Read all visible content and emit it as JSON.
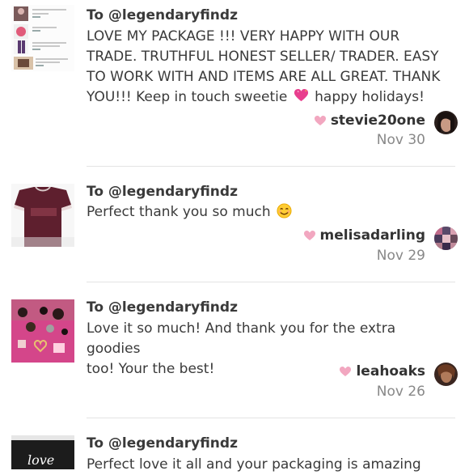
{
  "reviews": [
    {
      "to": "To @legendaryfindz",
      "body_lines": [
        "LOVE MY PACKAGE !!! VERY HAPPY WITH OUR",
        "TRADE. TRUTHFUL HONEST SELLER/ TRADER. EASY",
        "TO WORK WITH AND ITEMS ARE ALL GREAT. THANK",
        "YOU!!! Keep in touch sweetie",
        "happy holidays!"
      ],
      "username": "stevie20one",
      "date": "Nov 30"
    },
    {
      "to": "To @legendaryfindz",
      "body_lines": [
        "Perfect thank you so much"
      ],
      "username": "melisadarling",
      "date": "Nov 29"
    },
    {
      "to": "To @legendaryfindz",
      "body_lines": [
        "Love it so much! And thank you for the extra goodies",
        "too! Your the best!"
      ],
      "username": "leahoaks",
      "date": "Nov 26"
    },
    {
      "to": "To @legendaryfindz",
      "body_lines": [
        "Perfect love it all and your packaging is amazing"
      ],
      "username": "",
      "date": ""
    }
  ],
  "thumb_text": {
    "r1_lines": [
      "Pink Collage Tee",
      "Pink Bag",
      "Jeans Set",
      "Black Bag"
    ],
    "r4_logo": "love"
  },
  "colors": {
    "heart": "#f2a7c0",
    "text": "#3a3a3a",
    "muted": "#888888",
    "divider": "#e3e3e3"
  }
}
